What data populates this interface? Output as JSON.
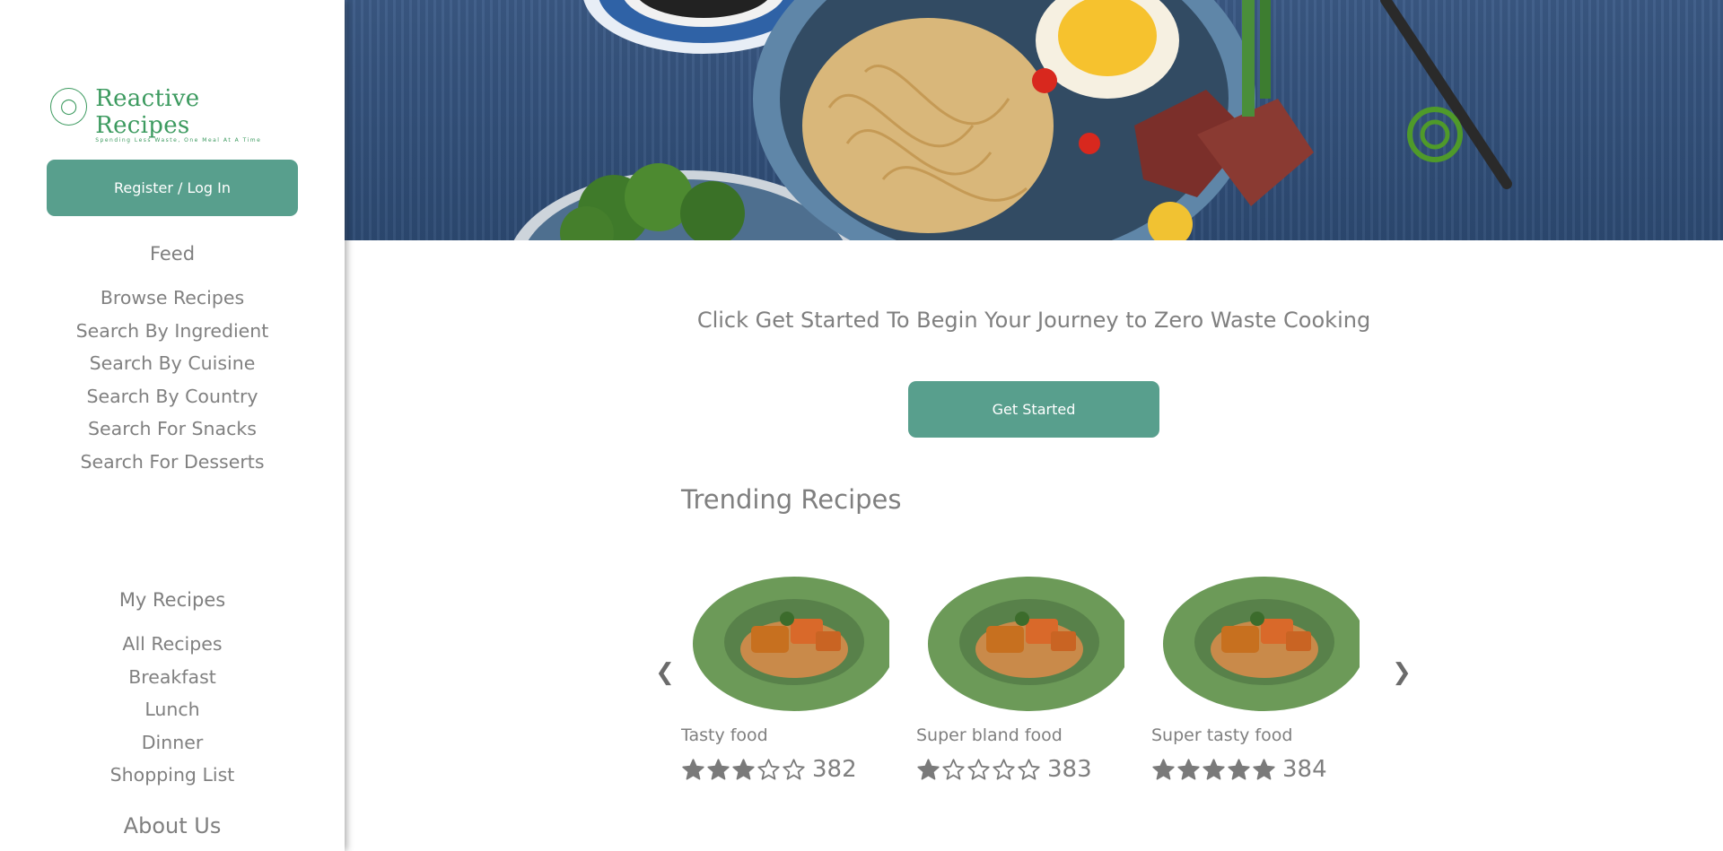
{
  "brand": {
    "name": "Reactive Recipes",
    "tagline": "Spending Less Waste, One Meal At A Time"
  },
  "auth": {
    "register_label": "Register / Log In"
  },
  "nav": {
    "feed_heading": "Feed",
    "feed_items": [
      "Browse Recipes",
      "Search By Ingredient",
      "Search By Cuisine",
      "Search By Country",
      "Search For Snacks",
      "Search For Desserts"
    ],
    "my_heading": "My Recipes",
    "my_items": [
      "All Recipes",
      "Breakfast",
      "Lunch",
      "Dinner",
      "Shopping List"
    ],
    "about_label": "About Us"
  },
  "main": {
    "tagline": "Click Get Started To Begin Your Journey to Zero Waste Cooking",
    "get_started_label": "Get Started",
    "trending_title": "Trending Recipes",
    "prev_icon": "chevron-left-icon",
    "next_icon": "chevron-right-icon"
  },
  "recipes": [
    {
      "name": "Tasty food",
      "rating": 3,
      "count": "382"
    },
    {
      "name": "Super bland food",
      "rating": 1,
      "count": "383"
    },
    {
      "name": "Super tasty food",
      "rating": 5,
      "count": "384"
    }
  ],
  "colors": {
    "accent": "#589f8d",
    "brand_green": "#3c9a5f",
    "text": "#7f7f7f"
  }
}
